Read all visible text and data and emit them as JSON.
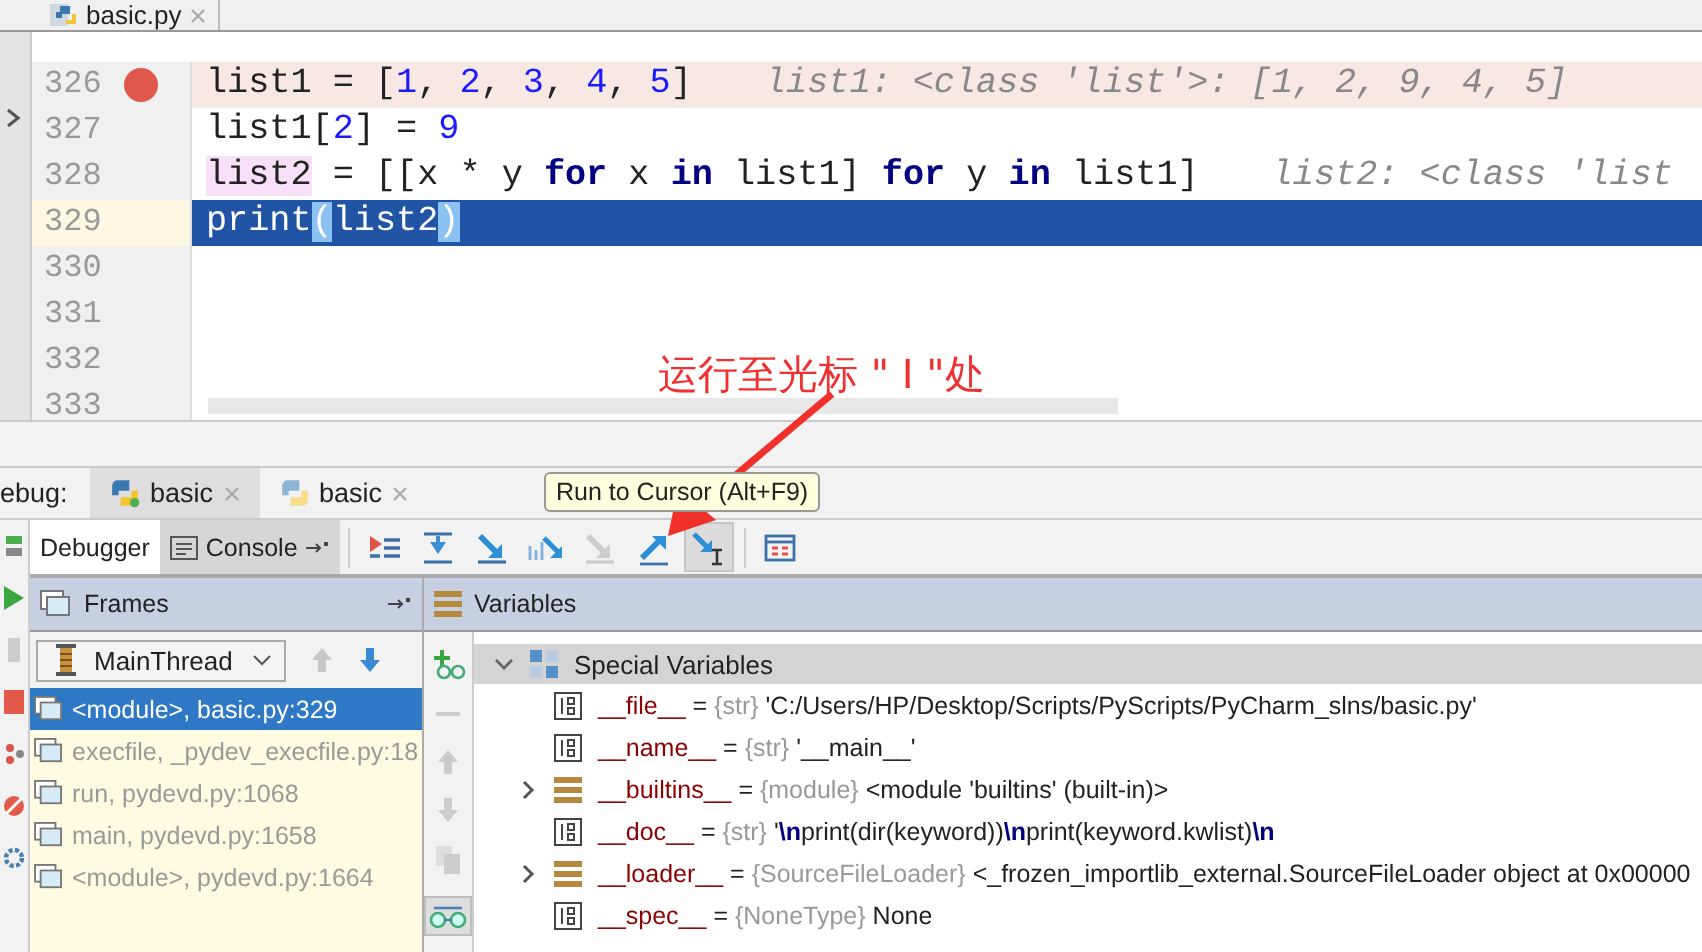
{
  "editor_tab": {
    "label": "basic.py"
  },
  "code_lines": [
    {
      "number": "326",
      "breakpoint": true,
      "current": false,
      "tokens": [
        {
          "text": "list1 = [",
          "kind": "plain"
        },
        {
          "text": "1",
          "kind": "number"
        },
        {
          "text": ", ",
          "kind": "plain"
        },
        {
          "text": "2",
          "kind": "number"
        },
        {
          "text": ", ",
          "kind": "plain"
        },
        {
          "text": "3",
          "kind": "number"
        },
        {
          "text": ", ",
          "kind": "plain"
        },
        {
          "text": "4",
          "kind": "number"
        },
        {
          "text": ", ",
          "kind": "plain"
        },
        {
          "text": "5",
          "kind": "number"
        },
        {
          "text": "]",
          "kind": "plain"
        }
      ],
      "hint": "list1: <class 'list'>: [1, 2, 9, 4, 5]"
    },
    {
      "number": "327",
      "breakpoint": false,
      "current": false,
      "tokens": [
        {
          "text": "list1[",
          "kind": "plain"
        },
        {
          "text": "2",
          "kind": "number"
        },
        {
          "text": "] = ",
          "kind": "plain"
        },
        {
          "text": "9",
          "kind": "number"
        }
      ]
    },
    {
      "number": "328",
      "breakpoint": false,
      "current": false,
      "tokens": [
        {
          "text": "list2",
          "kind": "usage"
        },
        {
          "text": " = [[x * y ",
          "kind": "plain"
        },
        {
          "text": "for",
          "kind": "keyword"
        },
        {
          "text": " x ",
          "kind": "plain"
        },
        {
          "text": "in",
          "kind": "keyword"
        },
        {
          "text": " list1] ",
          "kind": "plain"
        },
        {
          "text": "for",
          "kind": "keyword"
        },
        {
          "text": " y ",
          "kind": "plain"
        },
        {
          "text": "in",
          "kind": "keyword"
        },
        {
          "text": " list1]",
          "kind": "plain"
        }
      ],
      "hint": "list2: <class 'list"
    },
    {
      "number": "329",
      "breakpoint": false,
      "current": true,
      "tokens": [
        {
          "text": "print",
          "kind": "plain"
        },
        {
          "text": "(",
          "kind": "brace-match"
        },
        {
          "text": "list2",
          "kind": "plain"
        },
        {
          "text": ")",
          "kind": "brace-match"
        }
      ]
    },
    {
      "number": "330",
      "breakpoint": false,
      "current": false
    },
    {
      "number": "331",
      "breakpoint": false,
      "current": false
    },
    {
      "number": "332",
      "breakpoint": false,
      "current": false
    },
    {
      "number": "333",
      "breakpoint": false,
      "current": false
    }
  ],
  "annotation": {
    "text": "运行至光标 \" I \"处"
  },
  "debug": {
    "label": "ebug:",
    "tabs": [
      {
        "label": "basic",
        "selected": true
      },
      {
        "label": "basic",
        "selected": false
      }
    ]
  },
  "tooltip": "Run to Cursor (Alt+F9)",
  "toolbar_tabs": [
    {
      "label": "Debugger",
      "selected": true
    },
    {
      "label": "Console",
      "selected": false
    }
  ],
  "toolbar_buttons": [
    {
      "kind": "execution-point",
      "disabled": false,
      "hovered": false
    },
    {
      "kind": "step-over",
      "disabled": false,
      "hovered": false
    },
    {
      "kind": "step-into",
      "disabled": false,
      "hovered": false
    },
    {
      "kind": "step-into-my-code",
      "disabled": false,
      "hovered": false
    },
    {
      "kind": "force-step-into",
      "disabled": true,
      "hovered": false
    },
    {
      "kind": "step-out",
      "disabled": false,
      "hovered": false
    },
    {
      "kind": "run-to-cursor",
      "disabled": false,
      "hovered": true
    },
    {
      "kind": "evaluate",
      "disabled": false,
      "hovered": false
    }
  ],
  "frames": {
    "title": "Frames",
    "thread": "MainThread",
    "items": [
      {
        "label": "<module>, basic.py:329",
        "selected": true
      },
      {
        "label": "execfile, _pydev_execfile.py:18",
        "selected": false
      },
      {
        "label": "run, pydevd.py:1068",
        "selected": false
      },
      {
        "label": "main, pydevd.py:1658",
        "selected": false
      },
      {
        "label": "<module>, pydevd.py:1664",
        "selected": false
      }
    ]
  },
  "variables": {
    "title": "Variables",
    "group": {
      "label": "Special Variables",
      "expanded": true
    },
    "items": [
      {
        "name": "__file__",
        "sep": "=",
        "type": "{str}",
        "value": "'C:/Users/HP/Desktop/Scripts/PyScripts/PyCharm_slns/basic.py'",
        "kind": "value"
      },
      {
        "name": "__name__",
        "sep": "=",
        "type": "{str}",
        "value": "'__main__'",
        "kind": "value"
      },
      {
        "name": "__builtins__",
        "sep": "=",
        "type": "{module}",
        "value": "<module 'builtins' (built-in)>",
        "kind": "object",
        "expanded": false
      },
      {
        "name": "__doc__",
        "sep": "=",
        "type": "{str}",
        "value": "'**\\n**print(dir(keyword))**\\n**print(keyword.kwlist)**\\n**",
        "kind": "value"
      },
      {
        "name": "__loader__",
        "sep": "=",
        "type": "{SourceFileLoader}",
        "value": "<_frozen_importlib_external.SourceFileLoader object at 0x00000",
        "kind": "object",
        "expanded": false
      },
      {
        "name": "__spec__",
        "sep": "=",
        "type": "{NoneType}",
        "value": "None",
        "kind": "value"
      }
    ]
  }
}
